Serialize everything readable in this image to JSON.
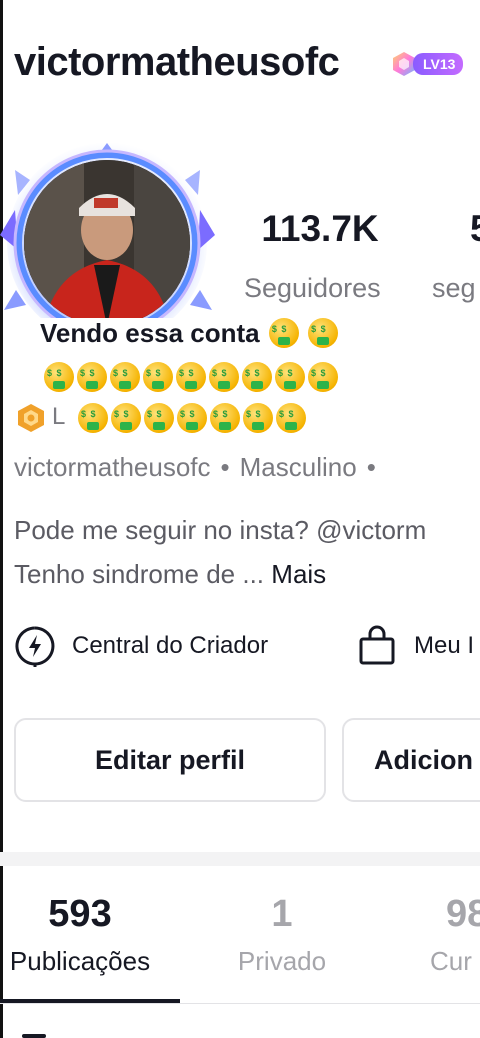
{
  "profile": {
    "username": "victormatheusofc",
    "level_badge": "LV13",
    "nickname": "Vendo essa conta",
    "handle": "victormatheusofc",
    "gender": "Masculino",
    "bio_line1": "Pode me seguir no insta? @victorm",
    "bio_line2": "Tenho sindrome de ...",
    "bio_more": "Mais",
    "badge_letter": "L"
  },
  "stats": {
    "followers_count": "113.7K",
    "followers_label": "Seguidores",
    "following_label": "seg",
    "following_count_partial": "5"
  },
  "tools": {
    "creator_center": "Central do Criador",
    "shop": "Meu I"
  },
  "buttons": {
    "edit_profile": "Editar perfil",
    "add": "Adicion"
  },
  "tabs": [
    {
      "count": "593",
      "label": "Publicações",
      "active": true
    },
    {
      "count": "1",
      "label": "Privado",
      "active": false
    },
    {
      "count": "98",
      "label": "Cur",
      "active": false
    }
  ],
  "icons": {
    "level_gem": "gem-icon",
    "money_emoji": "money-mouth-face-emoji",
    "creator": "lightning-bolt-icon",
    "shop": "shopping-bag-icon"
  },
  "colors": {
    "text_primary": "#161823",
    "text_secondary": "#7a7a80",
    "level_badge": "#9b5cff",
    "avatar_frame": "#7b6cff"
  },
  "emoji_rows": {
    "nickname_suffix_count": 2,
    "row2_count": 9,
    "row3_count": 7
  }
}
